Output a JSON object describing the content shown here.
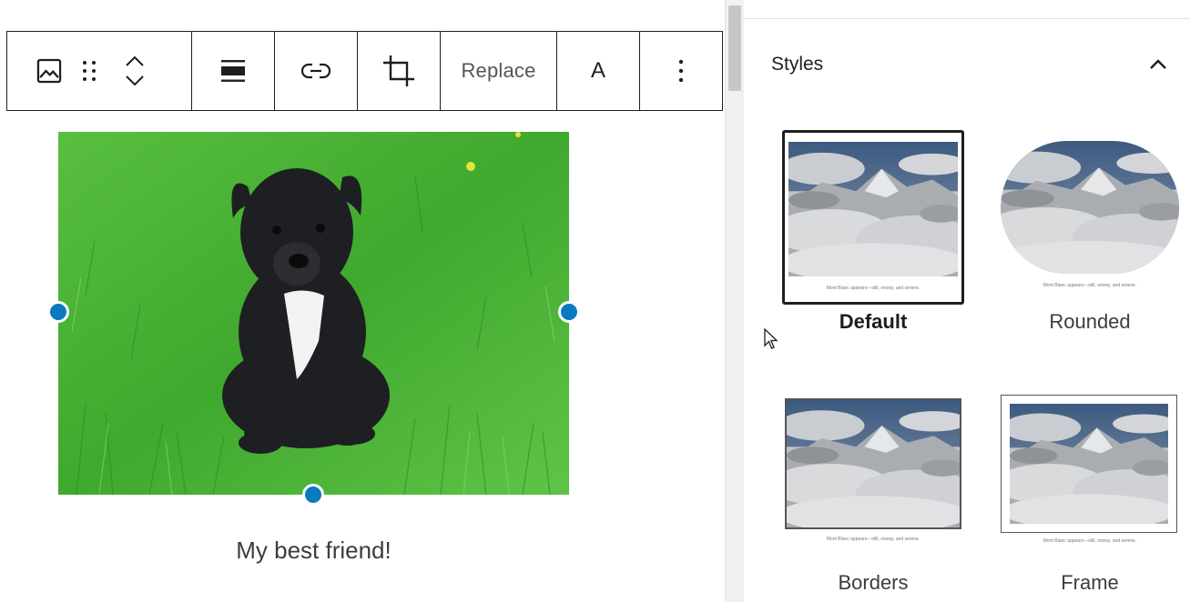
{
  "toolbar": {
    "buttons": [
      {
        "name": "image",
        "icon": "image-icon"
      },
      {
        "name": "drag",
        "icon": "drag-handle-icon"
      },
      {
        "name": "move-up",
        "icon": "chevron-up-icon"
      },
      {
        "name": "move-down",
        "icon": "chevron-down-icon"
      },
      {
        "name": "align",
        "icon": "align-full-icon"
      },
      {
        "name": "link",
        "icon": "link-icon"
      },
      {
        "name": "crop",
        "icon": "crop-icon"
      },
      {
        "name": "more",
        "icon": "more-vertical-icon"
      }
    ],
    "replace_label": "Replace",
    "text_label": "A"
  },
  "block": {
    "image_subject": "black puppy sitting in green grass",
    "caption": "My best friend!",
    "handle_color": "#0a7abf"
  },
  "sidebar": {
    "panel_title": "Styles",
    "panel_toggle_icon": "chevron-up-icon",
    "styles": [
      {
        "label": "Default",
        "selected": true,
        "preview_caption": "Mont Blanc appears—still, snowy, and serene."
      },
      {
        "label": "Rounded",
        "selected": false,
        "preview_caption": "Mont Blanc appears—still, snowy, and serene."
      },
      {
        "label": "Borders",
        "selected": false,
        "preview_caption": "Mont Blanc appears—still, snowy, and serene."
      },
      {
        "label": "Frame",
        "selected": false,
        "preview_caption": "Mont Blanc appears—still, snowy, and serene."
      }
    ]
  },
  "colors": {
    "accent": "#0a7abf",
    "border": "#1e1e1e",
    "grass": "#4fb83a"
  }
}
